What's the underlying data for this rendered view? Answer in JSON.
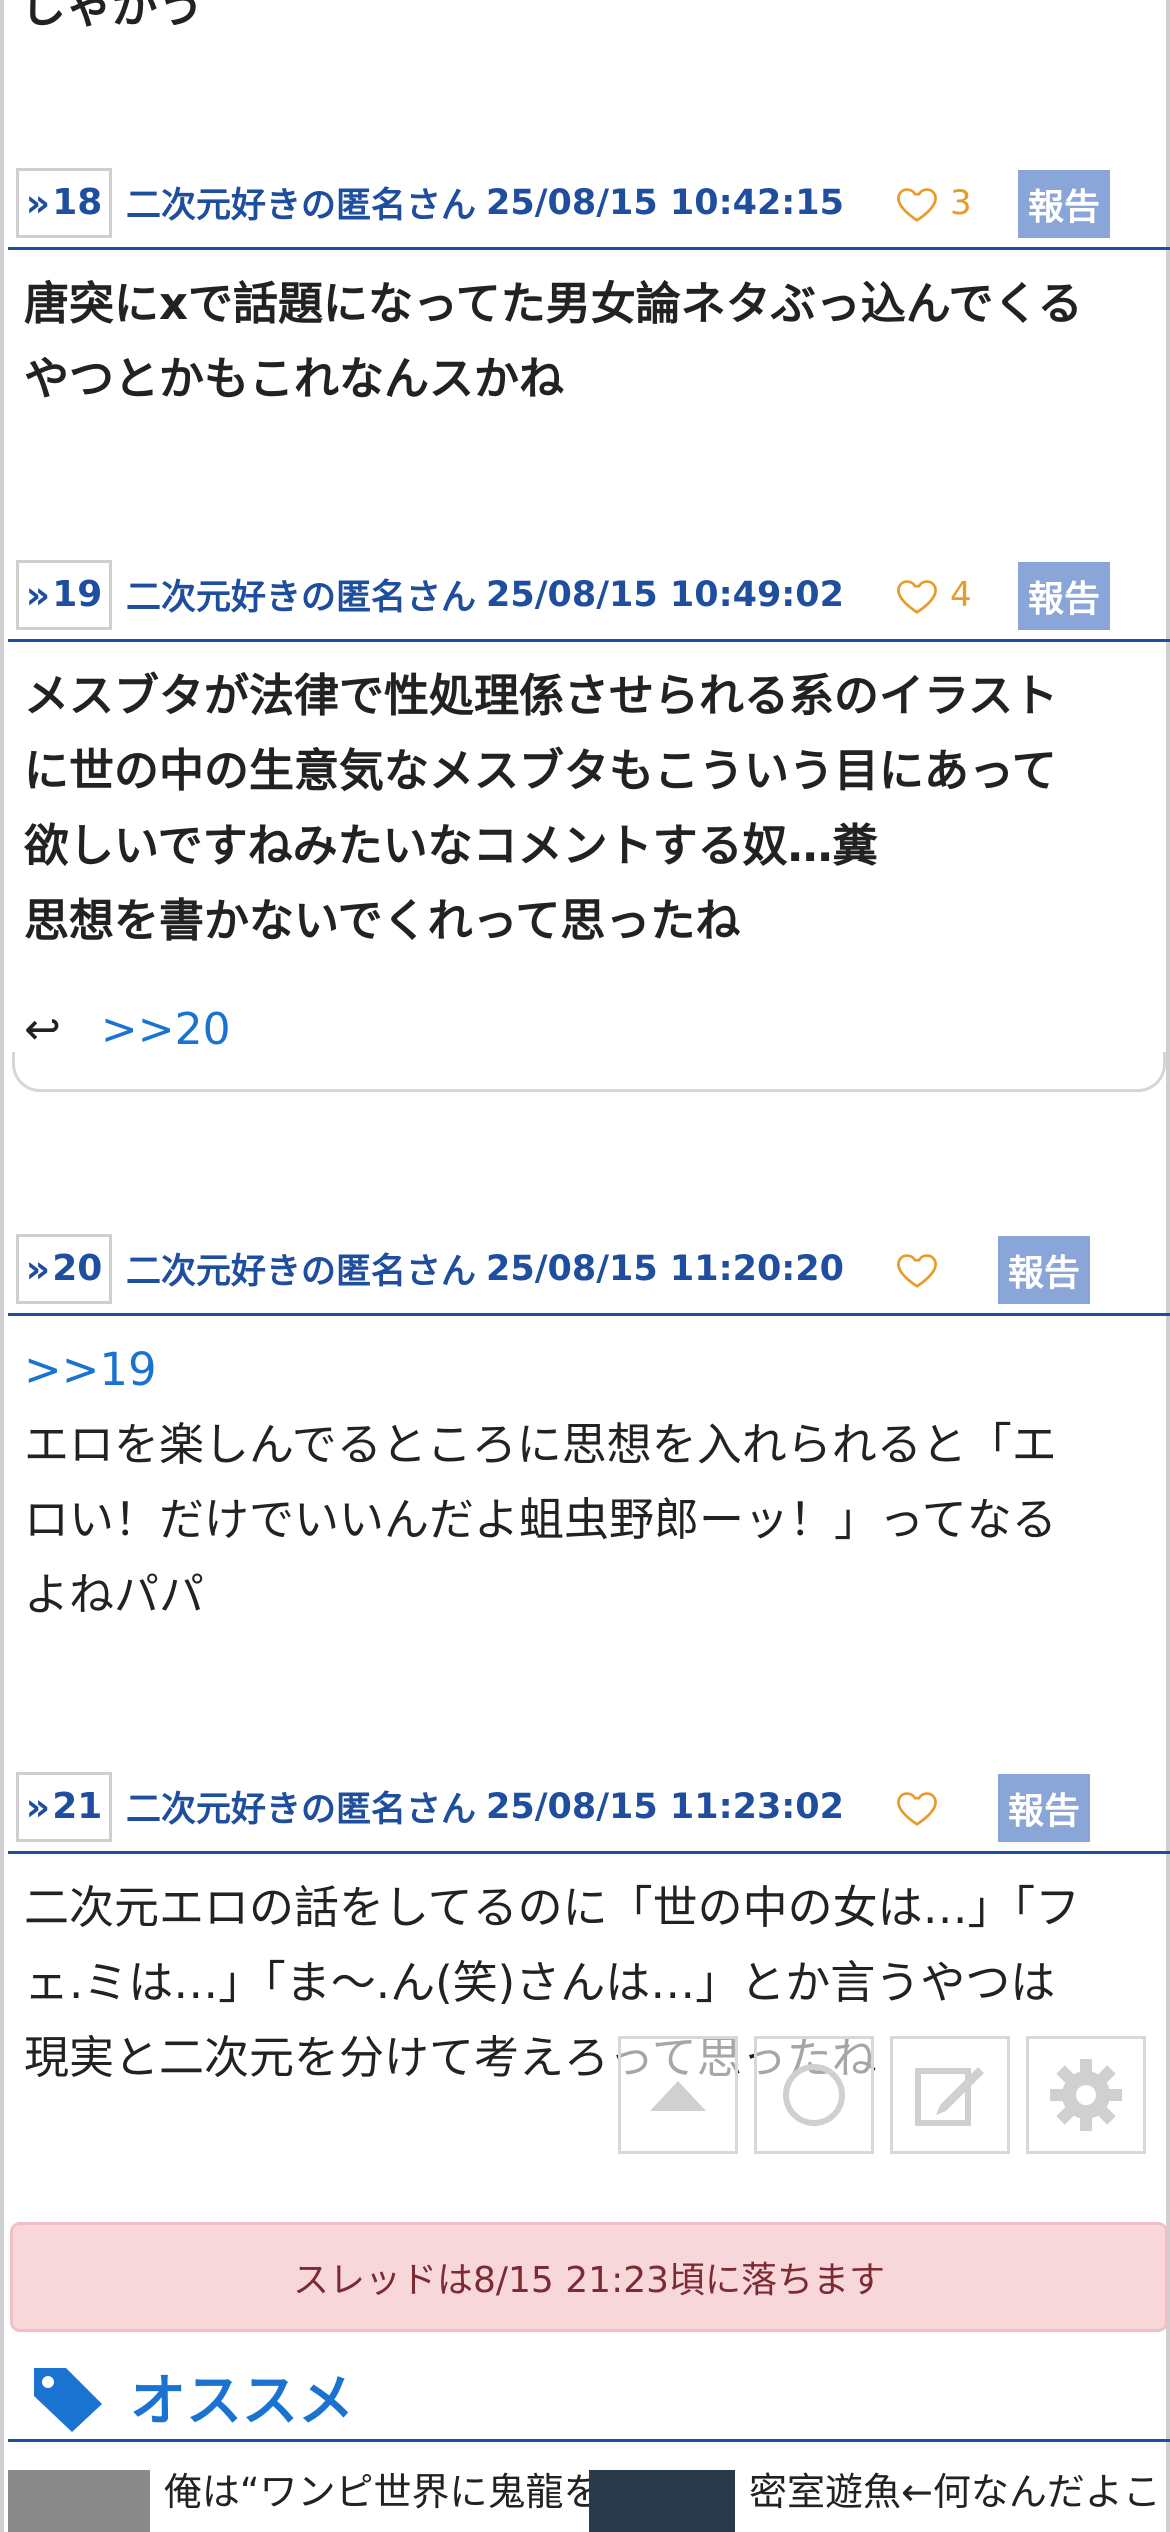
{
  "top_text": "しゃがう",
  "posts": [
    {
      "num": "18",
      "author": "二次元好きの匿名さん",
      "date": "25/08/15 10:42:15",
      "likes": "3",
      "report": "報告",
      "lines": [
        "唐突にxで話題になってた男女論ネタぶっ込んでくる",
        "やつとかもこれなんスかね"
      ]
    },
    {
      "num": "19",
      "author": "二次元好きの匿名さん",
      "date": "25/08/15 10:49:02",
      "likes": "4",
      "report": "報告",
      "lines": [
        "メスブタが法律で性処理係させられる系のイラスト",
        "に世の中の生意気なメスブタもこういう目にあって",
        "欲しいですねみたいなコメントする奴…糞",
        "思想を書かないでくれって思ったね"
      ],
      "reply_link": ">>20"
    },
    {
      "num": "20",
      "author": "二次元好きの匿名さん",
      "date": "25/08/15 11:20:20",
      "likes": "",
      "report": "報告",
      "anchor": ">>19",
      "lines": [
        "エロを楽しんでるところに思想を入れられると「エ",
        "ロい！だけでいいんだよ蛆虫野郎ーッ！」ってなる",
        "よねパパ"
      ]
    },
    {
      "num": "21",
      "author": "二次元好きの匿名さん",
      "date": "25/08/15 11:23:02",
      "likes": "",
      "report": "報告",
      "lines": [
        "二次元エロの話をしてるのに「世の中の女は…」「フ",
        "ェ.ミは…」「ま〜.ん(笑)さんは…」とか言うやつは",
        "現実と二次元を分けて考えろって思ったね"
      ]
    }
  ],
  "floating_buttons": [
    "scroll-top-icon",
    "reload-icon",
    "edit-icon",
    "settings-icon"
  ],
  "notice": "スレッドは8/15 21:23頃に落ちます",
  "recommend": {
    "title": "オススメ",
    "items": [
      {
        "text": "俺は“ワンピ世界に鬼龍を"
      },
      {
        "text": "密室遊魚←何なんだよこ"
      }
    ]
  },
  "colors": {
    "accent": "#1f4e9e",
    "link": "#1a73d1",
    "like": "#e79b2a",
    "report_bg": "#8aa6d8",
    "notice_bg": "#f8d7da"
  }
}
